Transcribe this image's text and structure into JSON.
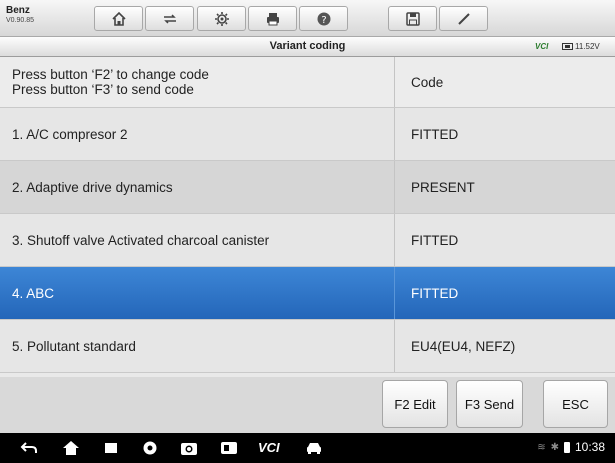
{
  "toolbar": {
    "brand_name": "Benz",
    "brand_version": "V0.90.85",
    "buttons": [
      "home-icon",
      "vehicle-swap-icon",
      "gear-icon",
      "printer-icon",
      "help-icon",
      "save-icon",
      "pen-icon"
    ]
  },
  "titlebar": {
    "title": "Variant coding",
    "vci_label": "VCI",
    "battery_voltage": "11.52V"
  },
  "table": {
    "header": {
      "instruction_1": "Press button ‘F2’ to change code",
      "instruction_2": "Press button ‘F3’ to send code",
      "column_value": "Code"
    },
    "rows": [
      {
        "label": "1. A/C compresor 2",
        "value": "FITTED"
      },
      {
        "label": "2. Adaptive drive dynamics",
        "value": "PRESENT"
      },
      {
        "label": "3. Shutoff valve Activated charcoal canister",
        "value": "FITTED"
      },
      {
        "label": "4. ABC",
        "value": "FITTED"
      },
      {
        "label": "5. Pollutant standard",
        "value": "EU4(EU4, NEFZ)"
      }
    ],
    "selected_row": 4,
    "selected_color": "#2e74c9"
  },
  "actions": {
    "f2_label": "F2 Edit",
    "f3_label": "F3 Send",
    "esc_label": "ESC"
  },
  "navbar": {
    "vci_label": "VCI",
    "time": "10:38",
    "icons": [
      "back-icon",
      "home-icon",
      "recent-apps-icon",
      "browser-icon",
      "camera-icon",
      "display-icon",
      "car-icon"
    ]
  }
}
